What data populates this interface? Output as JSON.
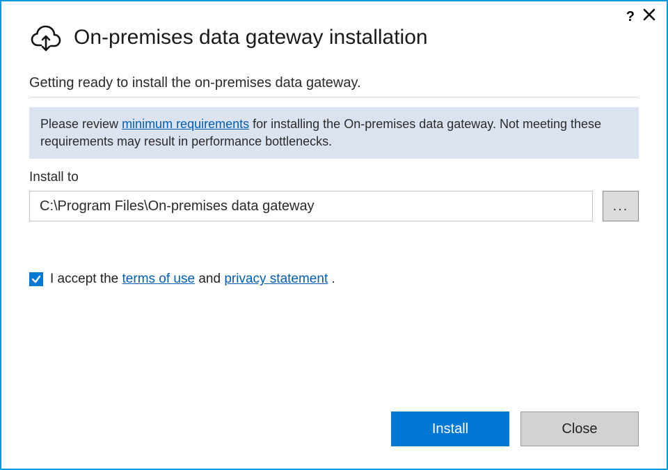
{
  "title": "On-premises data gateway installation",
  "subtitle": "Getting ready to install the on-premises data gateway.",
  "info": {
    "prefix": "Please review ",
    "link": "minimum requirements",
    "suffix": " for installing the On-premises data gateway. Not meeting these requirements may result in performance bottlenecks."
  },
  "install": {
    "label": "Install to",
    "path": "C:\\Program Files\\On-premises data gateway",
    "browse": "..."
  },
  "accept": {
    "checked": true,
    "prefix": "I accept the ",
    "terms": "terms of use",
    "mid": " and ",
    "privacy": "privacy statement",
    "suffix": " ."
  },
  "buttons": {
    "install": "Install",
    "close": "Close"
  }
}
